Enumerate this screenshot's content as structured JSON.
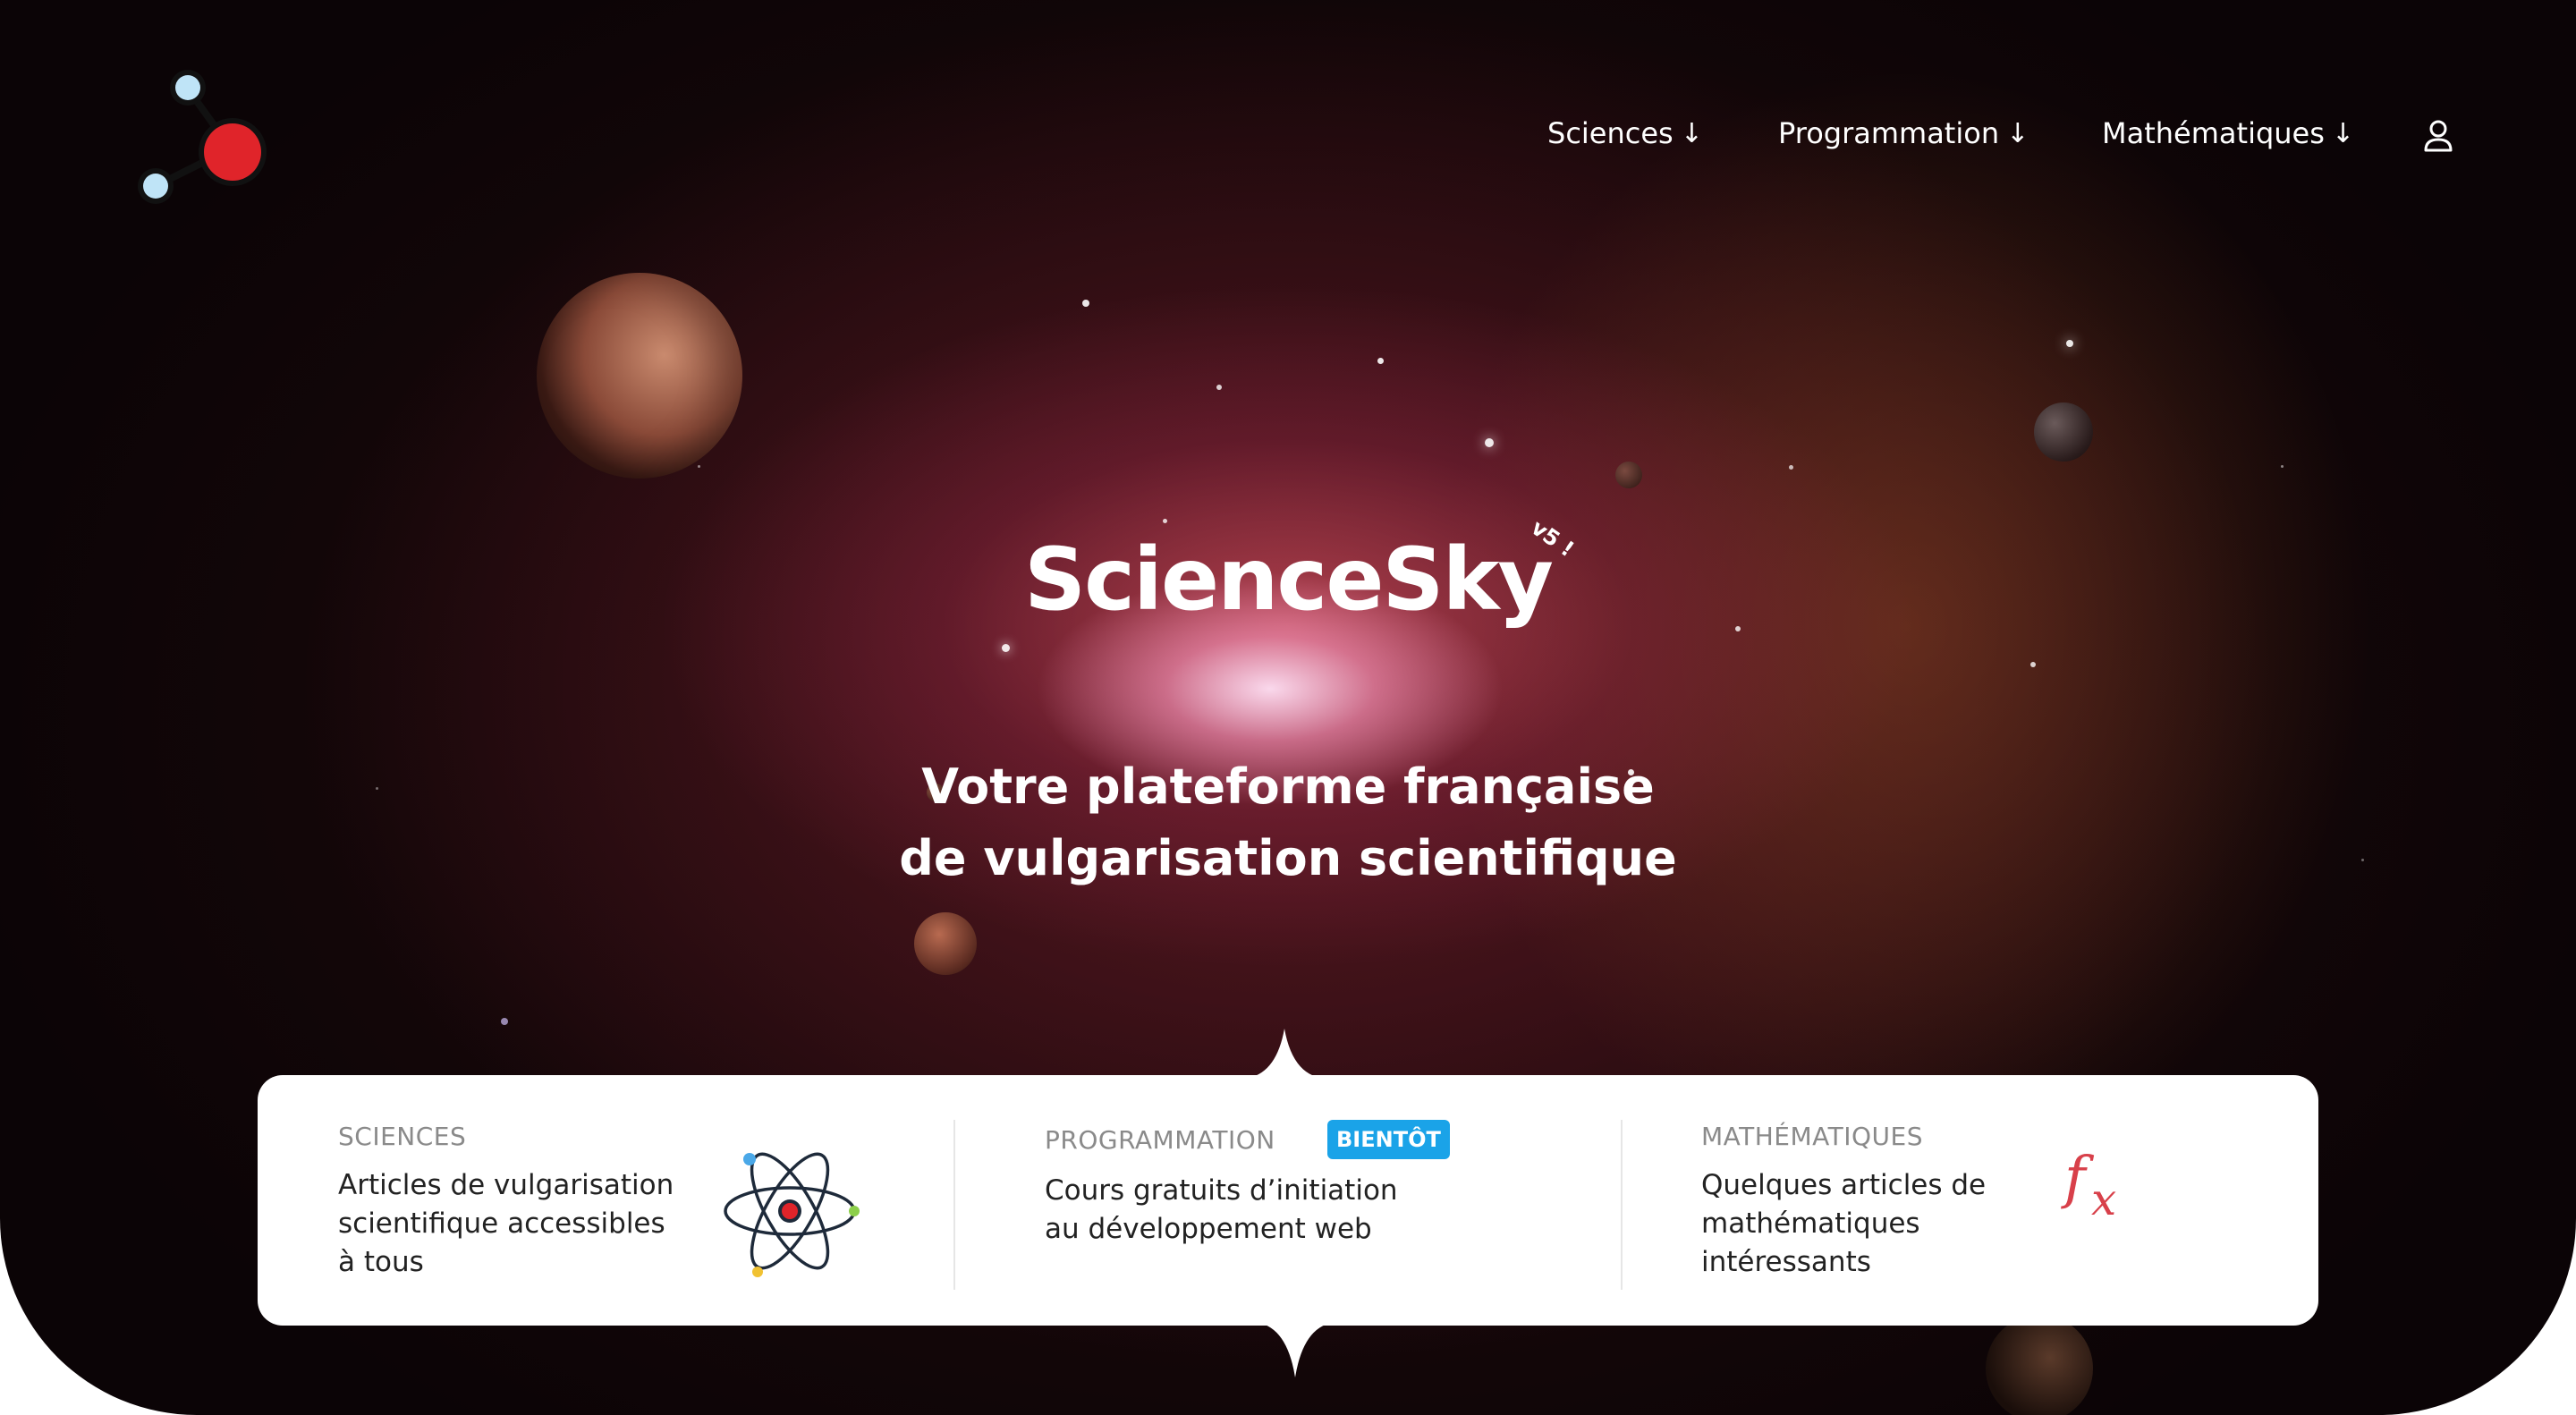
{
  "nav": {
    "items": [
      {
        "label": "Sciences",
        "arrow": "↓"
      },
      {
        "label": "Programmation",
        "arrow": "↓"
      },
      {
        "label": "Mathématiques",
        "arrow": "↓"
      }
    ]
  },
  "hero": {
    "brand": "ScienceSky",
    "version": "v5 !",
    "tagline_line1": "Votre plateforme française",
    "tagline_line2": "de vulgarisation scientifique"
  },
  "cards": [
    {
      "title": "SCIENCES",
      "description": "Articles de vulgarisation scientifique accessibles à tous",
      "icon": "atom-icon"
    },
    {
      "title": "PROGRAMMATION",
      "badge": "BIENTÔT",
      "description": "Cours gratuits d’initiation au développement web"
    },
    {
      "title": "MATHÉMATIQUES",
      "description": "Quelques articles de mathématiques intéressants",
      "icon": "function-icon"
    }
  ],
  "colors": {
    "badge": "#1aa3e8",
    "logo_red": "#e0242a",
    "logo_blue": "#bfe4f7",
    "fx_red": "#d8404a"
  }
}
